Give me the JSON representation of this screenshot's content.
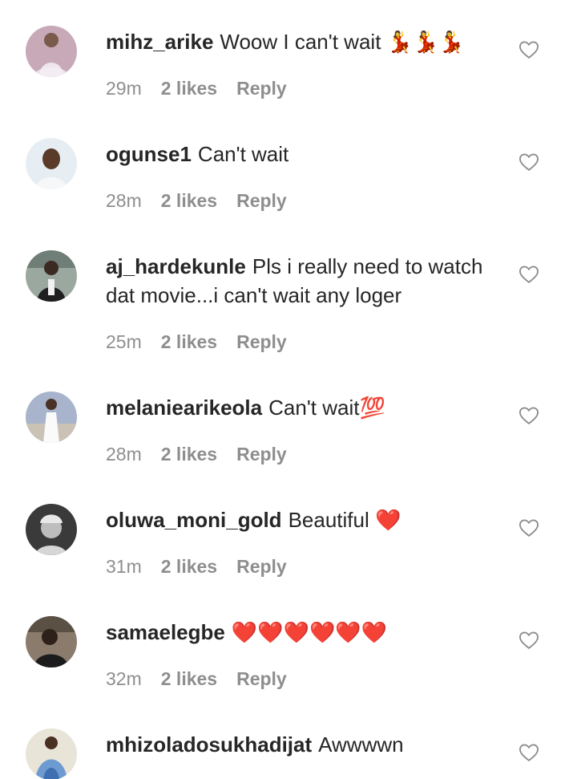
{
  "comments": [
    {
      "username": "mihz_arike",
      "text": "Woow I can't wait 💃💃💃",
      "time": "29m",
      "likes": "2 likes",
      "reply": "Reply",
      "avatar_color": "#c7a9b8"
    },
    {
      "username": "ogunse1",
      "text": "Can't wait",
      "time": "28m",
      "likes": "2 likes",
      "reply": "Reply",
      "avatar_color": "#e6eef3"
    },
    {
      "username": "aj_hardekunle",
      "text": "Pls i really need to watch dat movie...i can't wait any loger",
      "time": "25m",
      "likes": "2 likes",
      "reply": "Reply",
      "avatar_color": "#6f7f78"
    },
    {
      "username": "melaniearikeola",
      "text": "Can't wait💯",
      "time": "28m",
      "likes": "2 likes",
      "reply": "Reply",
      "avatar_color": "#a7b4cc"
    },
    {
      "username": "oluwa_moni_gold",
      "text": "Beautiful ❤️",
      "time": "31m",
      "likes": "2 likes",
      "reply": "Reply",
      "avatar_color": "#3a3a3a"
    },
    {
      "username": "samaelegbe",
      "text": "❤️❤️❤️❤️❤️❤️",
      "time": "32m",
      "likes": "2 likes",
      "reply": "Reply",
      "avatar_color": "#5b5044"
    },
    {
      "username": "mhizoladosukhadijat",
      "text": "Awwwwn",
      "time": "",
      "likes": "",
      "reply": "",
      "avatar_color": "#6d9bd1"
    }
  ],
  "colors": {
    "text": "#262626",
    "meta": "#8e8e8e",
    "heart_outline": "#8e8e8e"
  },
  "icons": {
    "like": "heart-outline-icon"
  }
}
